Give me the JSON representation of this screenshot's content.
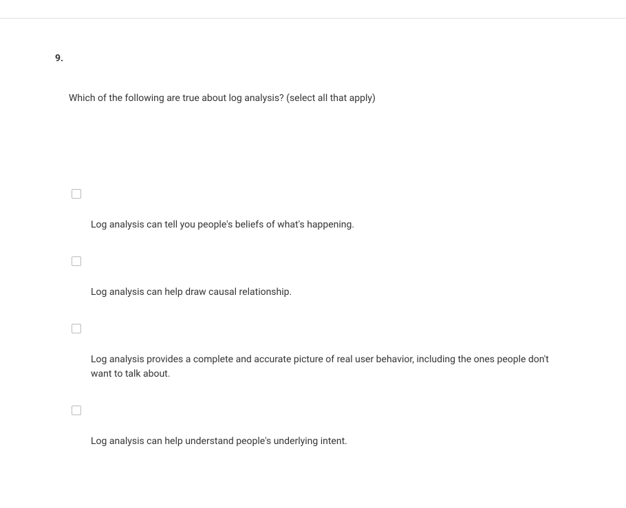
{
  "question": {
    "number": "9.",
    "text": "Which of the following are true about log analysis? (select all that apply)",
    "options": [
      {
        "label": "Log analysis can tell you people's beliefs of what's happening.",
        "checked": false
      },
      {
        "label": "Log analysis can help draw causal relationship.",
        "checked": false
      },
      {
        "label": "Log analysis provides a complete and accurate picture of real user behavior, including the ones people don't want to talk about.",
        "checked": false
      },
      {
        "label": "Log analysis can help understand people's underlying intent.",
        "checked": false
      }
    ]
  }
}
